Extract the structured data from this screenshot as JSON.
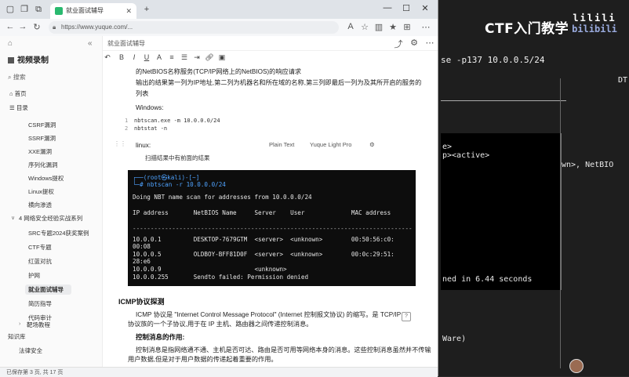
{
  "background": {
    "title": "CTF入门教学",
    "logo_top": "lilili",
    "logo_bottom": "bilibili",
    "command_line": "se -p137 10.0.0.5/24",
    "line_dt": "DT",
    "lines": [
      "e>",
      "p><active>",
      "wn>, NetBIO",
      "ned in 6.44 seconds",
      "Ware)"
    ]
  },
  "browser": {
    "tab_label": "就业面试辅导",
    "url": "https://www.yuque.com/...",
    "controls": {
      "min": "—",
      "max": "☐",
      "close": "✕"
    }
  },
  "sidebar": {
    "space_name": "视频录制",
    "search_placeholder": "搜索",
    "items": [
      {
        "label": "首页"
      },
      {
        "label": "目录"
      },
      {
        "label": "CSRF漏洞"
      },
      {
        "label": "SSRF漏洞"
      },
      {
        "label": "XXE漏洞"
      },
      {
        "label": "序列化漏洞"
      },
      {
        "label": "Windows提权"
      },
      {
        "label": "Linux提权"
      },
      {
        "label": "横向渗透"
      },
      {
        "label": "4 网络安全经验实战系列"
      },
      {
        "label": "SRC专题2024获奖案例"
      },
      {
        "label": "CTF专题"
      },
      {
        "label": "红蓝对抗"
      },
      {
        "label": "护网"
      },
      {
        "label": "就业面试辅导"
      },
      {
        "label": "简历指导"
      },
      {
        "label": "代码审计"
      },
      {
        "label": "靶场教程"
      },
      {
        "label": "知识库"
      },
      {
        "label": "法律安全"
      }
    ]
  },
  "editor": {
    "breadcrumb": "就业面试辅导",
    "intro_line1": "的NetBIOS名称服务(TCP/IP网络上的NetBIOS)的响应请求",
    "intro_line2": "输出的结果第一列为IP地址,第二列为机器名和所在域的名称,第三列即最后一列为及其所开启的服务的",
    "intro_line3": "列表",
    "windows_label": "Windows:",
    "win_code1": "nbtscan.exe -m 10.0.0.0/24",
    "win_code2": "nbtstat -n",
    "linux_label": "linux:",
    "plain_text": "Plain Text",
    "theme": "Yuque Light Pro",
    "linux_code": "扫描结果中有前面的结果",
    "terminal": {
      "prompt": "┌──(root㉿kali)-[~]",
      "cmd": "└─# nbtscan -r 10.0.0.0/24",
      "doing": "Doing NBT name scan for addresses from 10.0.0.0/24",
      "header": "IP address       NetBIOS Name     Server    User             MAC address",
      "dashes": "------------------------------------------------------------------------------",
      "r1": "10.0.0.1         DESKTOP-7679GTM  <server>  <unknown>        00:50:56:c0:",
      "r1b": "00:08",
      "r2": "10.0.0.5         OLDBOY-BFF81D0F  <server>  <unknown>        00:0c:29:51:",
      "r2b": "28:e6",
      "r3": "10.0.0.9                          <unknown>",
      "r4": "10.0.0.255       Sendto failed: Permission denied"
    },
    "icmp_heading": "ICMP协议探测",
    "icmp_p1": "ICMP 协议是 \"Internet Control Message Protocol\" (Internet 控制报文协议) 的缩写。是 TCP/IP",
    "icmp_p2": "协议族的一个子协议,用于在 IP 主机、路由器之间传递控制消息。",
    "ctrl_heading": "控制消息的作用:",
    "ctrl_p1": "控制消息是指网络通不通、主机是否可达、路由是否可用等网络本身的消息。这些控制消息虽然并不传输",
    "ctrl_p2": "用户数据,但是对于用户数据的传递起着重要的作用。"
  },
  "status": {
    "text": "已保存第 3 页, 共 17 页"
  }
}
